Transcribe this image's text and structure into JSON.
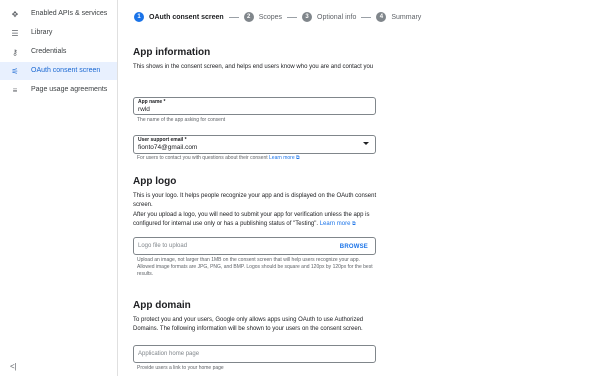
{
  "sidebar": {
    "items": [
      {
        "label": "Enabled APIs & services",
        "icon": "apis-icon"
      },
      {
        "label": "Library",
        "icon": "library-icon"
      },
      {
        "label": "Credentials",
        "icon": "key-icon"
      },
      {
        "label": "OAuth consent screen",
        "icon": "consent-icon"
      },
      {
        "label": "Page usage agreements",
        "icon": "agreements-icon"
      }
    ],
    "collapse": "<|"
  },
  "stepper": [
    {
      "num": "1",
      "label": "OAuth consent screen"
    },
    {
      "num": "2",
      "label": "Scopes"
    },
    {
      "num": "3",
      "label": "Optional info"
    },
    {
      "num": "4",
      "label": "Summary"
    }
  ],
  "app_information": {
    "title": "App information",
    "description": "This shows in the consent screen, and helps end users know who you are and contact you",
    "app_name": {
      "label": "App name *",
      "value": "rwld",
      "hint": "The name of the app asking for consent"
    },
    "support_email": {
      "label": "User support email *",
      "value": "fionto74@gmail.com",
      "hint": "For users to contact you with questions about their consent",
      "link": "Learn more"
    }
  },
  "app_logo": {
    "title": "App logo",
    "description1": "This is your logo. It helps people recognize your app and is displayed on the OAuth consent screen.",
    "description2": "After you upload a logo, you will need to submit your app for verification unless the app is configured for internal use only or has a publishing status of \"Testing\".",
    "link": "Learn more",
    "file_placeholder": "Logo file to upload",
    "browse": "BROWSE",
    "hint": "Upload an image, not larger than 1MB on the consent screen that will help users recognize your app. Allowed image formats are JPG, PNG, and BMP. Logos should be square and 120px by 120px for the best results."
  },
  "app_domain": {
    "title": "App domain",
    "description": "To protect you and your users, Google only allows apps using OAuth to use Authorized Domains. The following information will be shown to your users on the consent screen.",
    "home_page_placeholder": "Application home page",
    "home_page_hint": "Provide users a link to your home page"
  },
  "colors": {
    "accent": "#1a73e8",
    "active_bg": "#e8f0fe"
  }
}
